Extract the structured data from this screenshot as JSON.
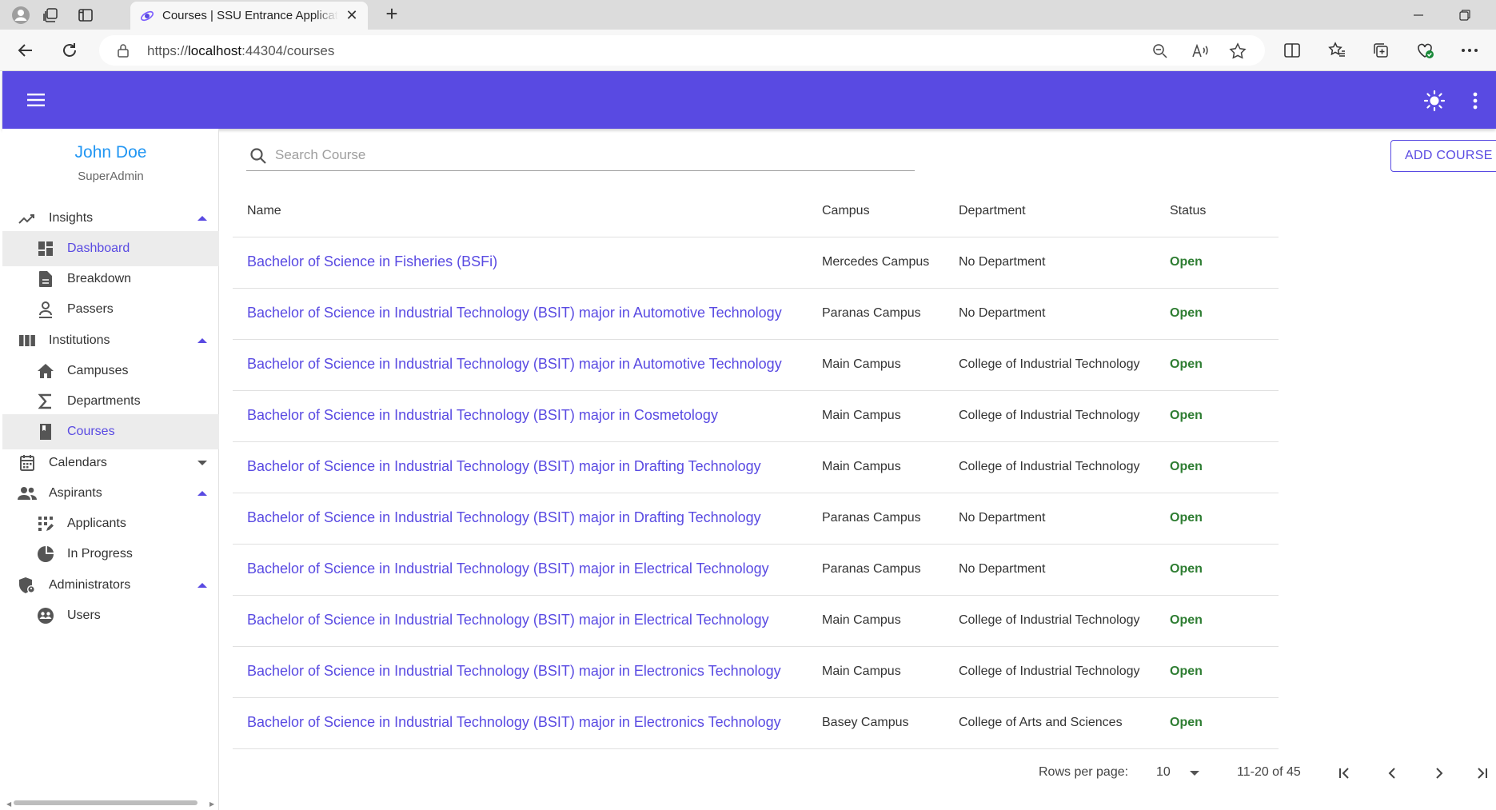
{
  "browser": {
    "tab_title": "Courses | SSU Entrance Application",
    "url_prefix": "https://",
    "url_host": "localhost",
    "url_rest": ":44304/courses"
  },
  "user": {
    "name": "John Doe",
    "role": "SuperAdmin"
  },
  "sidebar": {
    "items": [
      {
        "label": "Insights",
        "icon": "trending-icon"
      },
      {
        "label": "Dashboard",
        "icon": "dashboard-icon"
      },
      {
        "label": "Breakdown",
        "icon": "description-icon"
      },
      {
        "label": "Passers",
        "icon": "person-icon"
      },
      {
        "label": "Institutions",
        "icon": "columns-icon"
      },
      {
        "label": "Campuses",
        "icon": "home-icon"
      },
      {
        "label": "Departments",
        "icon": "sigma-icon"
      },
      {
        "label": "Courses",
        "icon": "book-icon"
      },
      {
        "label": "Calendars",
        "icon": "calendar-icon"
      },
      {
        "label": "Aspirants",
        "icon": "group-icon"
      },
      {
        "label": "Applicants",
        "icon": "apps-icon"
      },
      {
        "label": "In Progress",
        "icon": "pie-icon"
      },
      {
        "label": "Administrators",
        "icon": "shield-icon"
      },
      {
        "label": "Users",
        "icon": "users-icon"
      }
    ]
  },
  "search": {
    "placeholder": "Search Course"
  },
  "toolbar": {
    "add_label": "ADD COURSE"
  },
  "table": {
    "headers": {
      "name": "Name",
      "campus": "Campus",
      "department": "Department",
      "status": "Status"
    },
    "rows": [
      {
        "name": "Bachelor of Science in Fisheries (BSFi)",
        "campus": "Mercedes Campus",
        "department": "No Department",
        "status": "Open"
      },
      {
        "name": "Bachelor of Science in Industrial Technology (BSIT) major in Automotive Technology",
        "campus": "Paranas Campus",
        "department": "No Department",
        "status": "Open"
      },
      {
        "name": "Bachelor of Science in Industrial Technology (BSIT) major in Automotive Technology",
        "campus": "Main Campus",
        "department": "College of Industrial Technology",
        "status": "Open"
      },
      {
        "name": "Bachelor of Science in Industrial Technology (BSIT) major in Cosmetology",
        "campus": "Main Campus",
        "department": "College of Industrial Technology",
        "status": "Open"
      },
      {
        "name": "Bachelor of Science in Industrial Technology (BSIT) major in Drafting Technology",
        "campus": "Main Campus",
        "department": "College of Industrial Technology",
        "status": "Open"
      },
      {
        "name": "Bachelor of Science in Industrial Technology (BSIT) major in Drafting Technology",
        "campus": "Paranas Campus",
        "department": "No Department",
        "status": "Open"
      },
      {
        "name": "Bachelor of Science in Industrial Technology (BSIT) major in Electrical Technology",
        "campus": "Paranas Campus",
        "department": "No Department",
        "status": "Open"
      },
      {
        "name": "Bachelor of Science in Industrial Technology (BSIT) major in Electrical Technology",
        "campus": "Main Campus",
        "department": "College of Industrial Technology",
        "status": "Open"
      },
      {
        "name": "Bachelor of Science in Industrial Technology (BSIT) major in Electronics Technology",
        "campus": "Main Campus",
        "department": "College of Industrial Technology",
        "status": "Open"
      },
      {
        "name": "Bachelor of Science in Industrial Technology (BSIT) major in Electronics Technology",
        "campus": "Basey Campus",
        "department": "College of Arts and Sciences",
        "status": "Open"
      }
    ]
  },
  "pagination": {
    "rows_per_page_label": "Rows per page:",
    "rows_per_page": "10",
    "range": "11-20 of 45"
  },
  "colors": {
    "primary": "#594ae2",
    "open_status": "#2e7d32",
    "user_name": "#2196f3"
  }
}
